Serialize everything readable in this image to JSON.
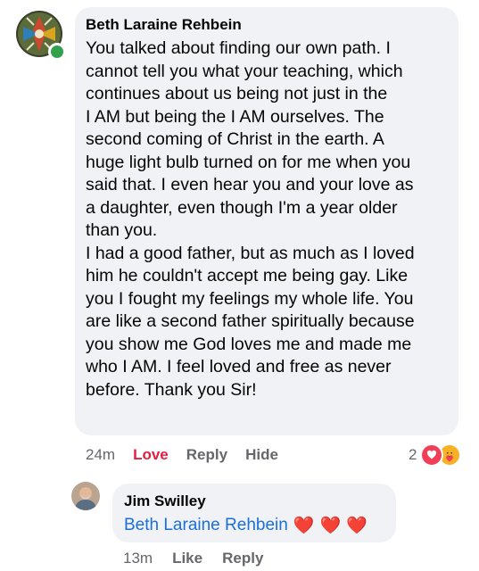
{
  "comment": {
    "author": "Beth Laraine Rehbein",
    "paragraph1": "You talked about finding our own path. I\ncannot tell you what your teaching, which\ncontinues about us being not just in the\n I AM but being the I AM ourselves. The\nsecond coming of Christ in the earth. A\nhuge light bulb turned on for me when you\nsaid that. I even hear you and your love as\na daughter, even though I'm a year older\nthan you.",
    "paragraph2": "I had a good father, but as much as I loved\nhim he couldn't accept me being gay. Like\nyou I fought my feelings my whole life. You\nare like a second father spiritually because\nyou show me God loves me and made me\nwho I AM. I feel loved and free as never\nbefore. Thank you Sir!",
    "timestamp": "24m",
    "love_label": "Love",
    "reply_label": "Reply",
    "hide_label": "Hide",
    "reaction_count": "2",
    "online_color": "#31a24c"
  },
  "reply": {
    "author": "Jim Swilley",
    "mention": "Beth Laraine Rehbein",
    "hearts": [
      "❤️",
      "❤️",
      "❤️"
    ],
    "timestamp": "13m",
    "like_label": "Like",
    "reply_label": "Reply"
  },
  "colors": {
    "bubble": "#f0f2f5",
    "love": "#e41e3f",
    "mention": "#1b6fd9",
    "meta": "#65676b"
  }
}
